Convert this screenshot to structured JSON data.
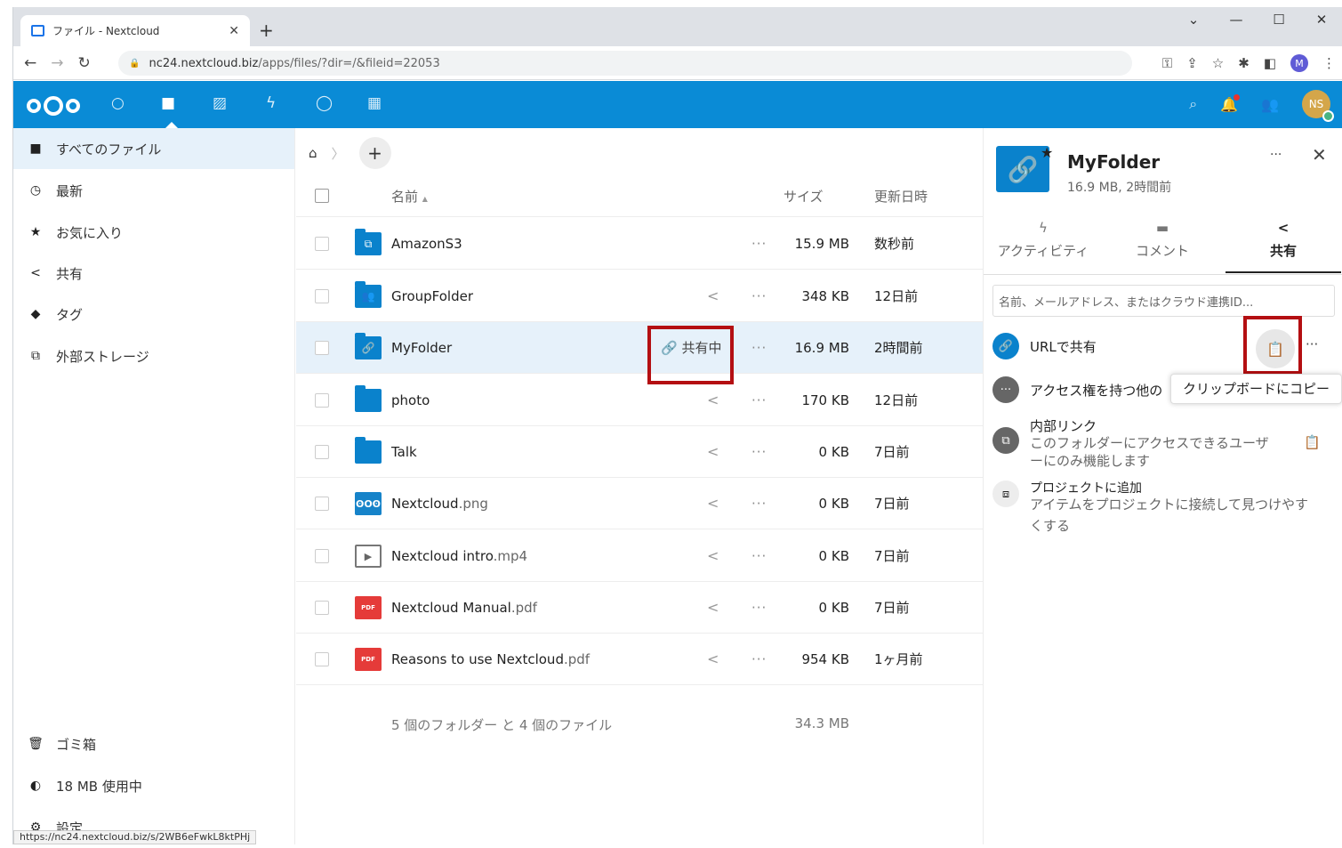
{
  "browser": {
    "tab_title": "ファイル - Nextcloud",
    "tab_close": "✕",
    "new_tab": "+",
    "url_host": "nc24.nextcloud.biz",
    "url_path": "/apps/files/?dir=/&fileid=22053",
    "profile_initial": "M",
    "status_url": "https://nc24.nextcloud.biz/s/2WB6eFwkL8ktPHj"
  },
  "header": {
    "avatar_initials": "NS"
  },
  "nav": {
    "all_files": "すべてのファイル",
    "recent": "最新",
    "favorites": "お気に入り",
    "shared": "共有",
    "tags": "タグ",
    "external_storage": "外部ストレージ",
    "trash": "ゴミ箱",
    "quota": "18 MB 使用中",
    "settings": "設定"
  },
  "files": {
    "col_name": "名前",
    "sort_indicator": "▲",
    "col_size": "サイズ",
    "col_modified": "更新日時",
    "shared_label": "共有中",
    "rows": [
      {
        "base": "AmazonS3",
        "ext": "",
        "size": "15.9 MB",
        "modified": "数秒前"
      },
      {
        "base": "GroupFolder",
        "ext": "",
        "size": "348 KB",
        "modified": "12日前"
      },
      {
        "base": "MyFolder",
        "ext": "",
        "size": "16.9 MB",
        "modified": "2時間前"
      },
      {
        "base": "photo",
        "ext": "",
        "size": "170 KB",
        "modified": "12日前"
      },
      {
        "base": "Talk",
        "ext": "",
        "size": "0 KB",
        "modified": "7日前"
      },
      {
        "base": "Nextcloud",
        "ext": ".png",
        "size": "0 KB",
        "modified": "7日前"
      },
      {
        "base": "Nextcloud intro",
        "ext": ".mp4",
        "size": "0 KB",
        "modified": "7日前"
      },
      {
        "base": "Nextcloud Manual",
        "ext": ".pdf",
        "size": "0 KB",
        "modified": "7日前"
      },
      {
        "base": "Reasons to use Nextcloud",
        "ext": ".pdf",
        "size": "954 KB",
        "modified": "1ヶ月前"
      }
    ],
    "summary_text": "5 個のフォルダー と 4 個のファイル",
    "summary_size": "34.3 MB",
    "pdf_badge": "PDF"
  },
  "sidebar": {
    "title": "MyFolder",
    "subtitle": "16.9 MB, 2時間前",
    "tabs": {
      "activity": "アクティビティ",
      "comments": "コメント",
      "sharing": "共有"
    },
    "search_placeholder": "名前、メールアドレス、またはクラウド連携ID...",
    "share_link": "URLで共有",
    "others_access": "アクセス権を持つ他の",
    "tooltip": "クリップボードにコピー",
    "internal_link_title": "内部リンク",
    "internal_link_desc_1": "このフォルダーにアクセスできるユーザ",
    "internal_link_desc_2": "ーにのみ機能します",
    "project_title": "プロジェクトに追加",
    "project_desc_1": "アイテムをプロジェクトに接続して見つけやす",
    "project_desc_2": "くする"
  },
  "colors": {
    "brand": "#0a8bd6",
    "highlight": "#b40f12",
    "selected_row": "#e6f1fa"
  }
}
